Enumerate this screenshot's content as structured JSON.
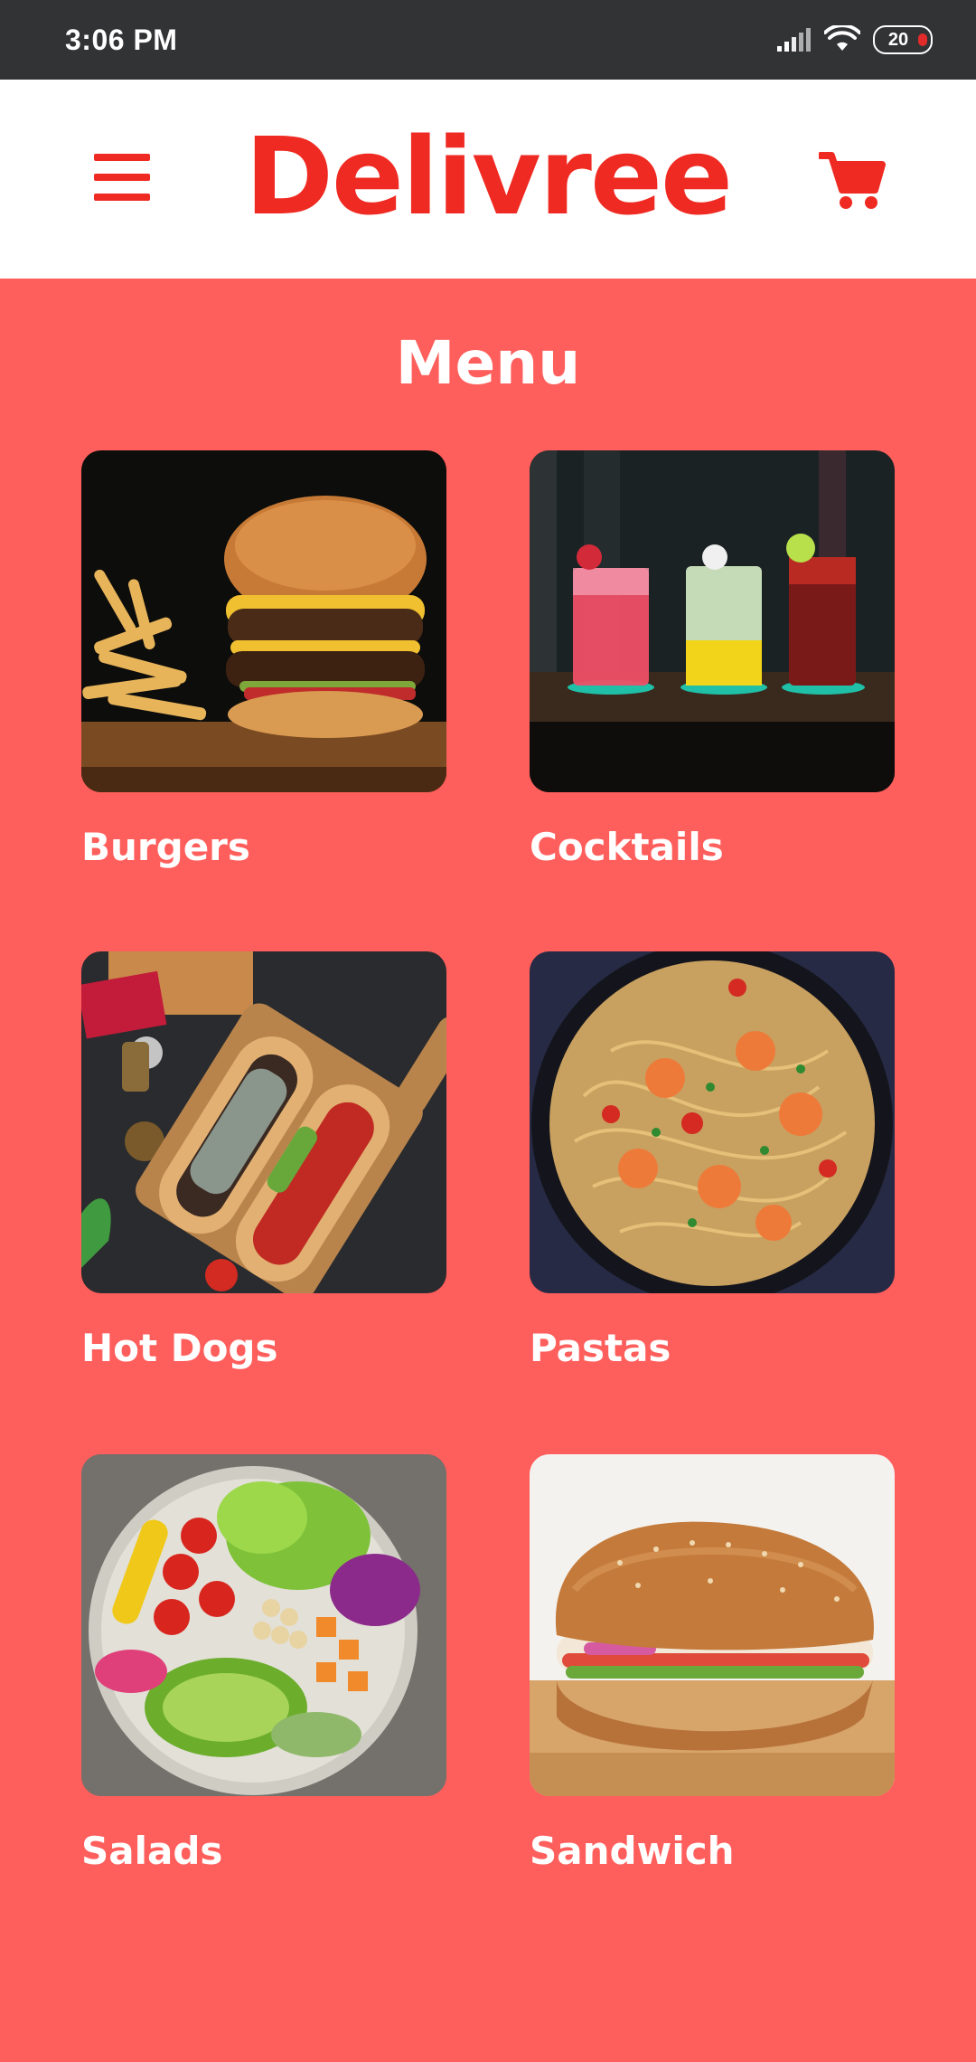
{
  "status_bar": {
    "time": "3:06 PM",
    "battery": "20"
  },
  "header": {
    "brand": "Delivree"
  },
  "page": {
    "title": "Menu"
  },
  "menu": {
    "items": [
      {
        "label": "Burgers",
        "image": "burger-photo"
      },
      {
        "label": "Cocktails",
        "image": "cocktails-photo"
      },
      {
        "label": "Hot Dogs",
        "image": "hot-dogs-photo"
      },
      {
        "label": "Pastas",
        "image": "pasta-photo"
      },
      {
        "label": "Salads",
        "image": "salad-photo"
      },
      {
        "label": "Sandwich",
        "image": "sandwich-photo"
      }
    ]
  },
  "colors": {
    "brand_red": "#EF2A22",
    "background": "#FF5F5C",
    "status_bar": "#323335"
  }
}
